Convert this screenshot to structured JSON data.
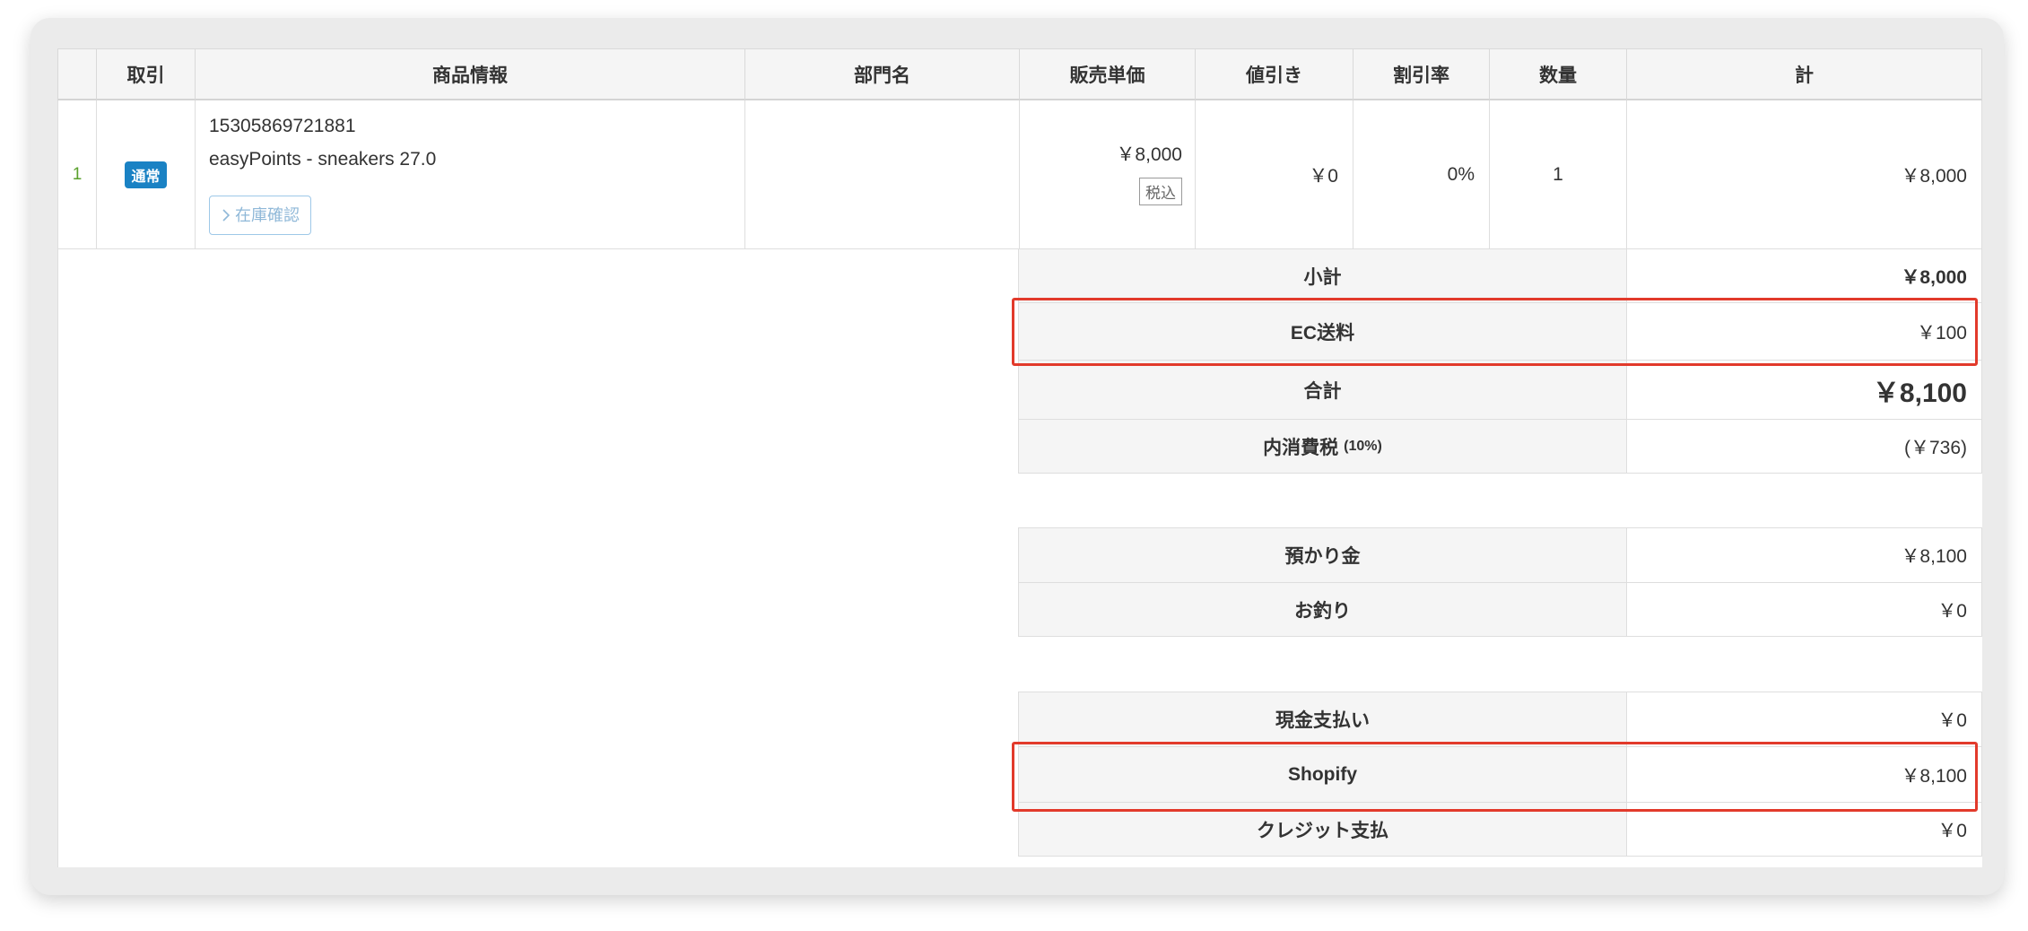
{
  "table": {
    "columns": [
      "",
      "取引",
      "商品情報",
      "部門名",
      "販売単価",
      "値引き",
      "割引率",
      "数量",
      "計"
    ],
    "row": {
      "number": "1",
      "type_badge": "通常",
      "product_code": "15305869721881",
      "product_name": "easyPoints - sneakers 27.0",
      "stock_button": "在庫確認",
      "department": "",
      "unit_price": "￥8,000",
      "tax_tag": "税込",
      "discount": "￥0",
      "discount_rate": "0%",
      "quantity": "1",
      "total": "￥8,000"
    }
  },
  "summary": {
    "subtotal_label": "小計",
    "subtotal_value": "￥8,000",
    "shipping_label": "EC送料",
    "shipping_value": "￥100",
    "total_label": "合計",
    "total_value": "￥8,100",
    "tax_label": "内消費税",
    "tax_rate": "(10%)",
    "tax_value": "(￥736)"
  },
  "payment": {
    "deposit_label": "預かり金",
    "deposit_value": "￥8,100",
    "change_label": "お釣り",
    "change_value": "￥0"
  },
  "methods": {
    "cash_label": "現金支払い",
    "cash_value": "￥0",
    "shopify_label": "Shopify",
    "shopify_value": "￥8,100",
    "credit_label": "クレジット支払",
    "credit_value": "￥0"
  },
  "colors": {
    "highlight": "#e23a2b",
    "badge": "#1a82c4",
    "row_number": "#5aa02c"
  }
}
